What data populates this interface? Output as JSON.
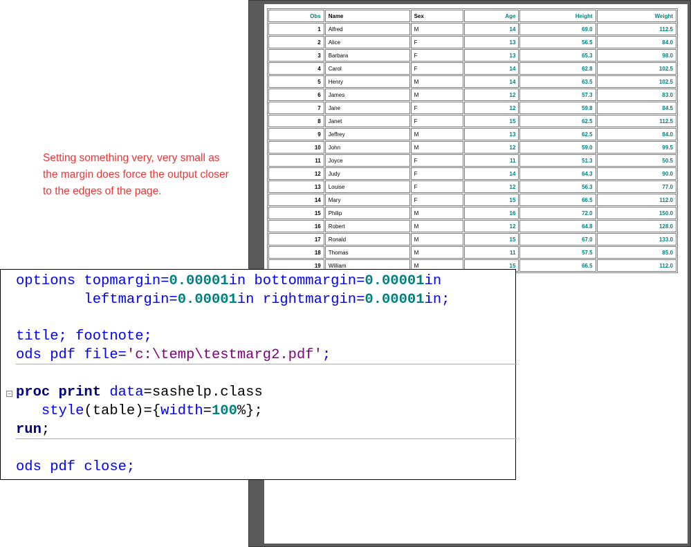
{
  "annotation": "Setting something very, very small as the margin does force the output closer to the edges of the page.",
  "table": {
    "columns": [
      "Obs",
      "Name",
      "Sex",
      "Age",
      "Height",
      "Weight"
    ],
    "rows": [
      [
        "1",
        "Alfred",
        "M",
        "14",
        "69.0",
        "112.5"
      ],
      [
        "2",
        "Alice",
        "F",
        "13",
        "56.5",
        "84.0"
      ],
      [
        "3",
        "Barbara",
        "F",
        "13",
        "65.3",
        "98.0"
      ],
      [
        "4",
        "Carol",
        "F",
        "14",
        "62.8",
        "102.5"
      ],
      [
        "5",
        "Henry",
        "M",
        "14",
        "63.5",
        "102.5"
      ],
      [
        "6",
        "James",
        "M",
        "12",
        "57.3",
        "83.0"
      ],
      [
        "7",
        "Jane",
        "F",
        "12",
        "59.8",
        "84.5"
      ],
      [
        "8",
        "Janet",
        "F",
        "15",
        "62.5",
        "112.5"
      ],
      [
        "9",
        "Jeffrey",
        "M",
        "13",
        "62.5",
        "84.0"
      ],
      [
        "10",
        "John",
        "M",
        "12",
        "59.0",
        "99.5"
      ],
      [
        "11",
        "Joyce",
        "F",
        "11",
        "51.3",
        "50.5"
      ],
      [
        "12",
        "Judy",
        "F",
        "14",
        "64.3",
        "90.0"
      ],
      [
        "13",
        "Louise",
        "F",
        "12",
        "56.3",
        "77.0"
      ],
      [
        "14",
        "Mary",
        "F",
        "15",
        "66.5",
        "112.0"
      ],
      [
        "15",
        "Philip",
        "M",
        "16",
        "72.0",
        "150.0"
      ],
      [
        "16",
        "Robert",
        "M",
        "12",
        "64.8",
        "128.0"
      ],
      [
        "17",
        "Ronald",
        "M",
        "15",
        "67.0",
        "133.0"
      ],
      [
        "18",
        "Thomas",
        "M",
        "11",
        "57.5",
        "85.0"
      ],
      [
        "19",
        "William",
        "M",
        "15",
        "66.5",
        "112.0"
      ]
    ]
  },
  "code": {
    "l1": {
      "a": "options topmargin=",
      "b": "0.00001",
      "c": "in bottommargin=",
      "d": "0.00001",
      "e": "in"
    },
    "l2": {
      "a": "        leftmargin=",
      "b": "0.00001",
      "c": "in rightmargin=",
      "d": "0.00001",
      "e": "in;"
    },
    "l3": {
      "a": "title; footnote;"
    },
    "l4": {
      "a": "ods pdf file=",
      "b": "'c:\\temp\\testmarg2.pdf'",
      "c": ";"
    },
    "l5": {
      "a": "proc print",
      "b": " data",
      "c": "=sashelp.class"
    },
    "l6": {
      "a": "   style",
      "b": "(table)={",
      "c": "width",
      "d": "=",
      "e": "100",
      "f": "%};"
    },
    "l7": {
      "a": "run",
      "b": ";"
    },
    "l8": {
      "a": "ods pdf close;"
    },
    "fold_icon": "minus-box-icon"
  }
}
